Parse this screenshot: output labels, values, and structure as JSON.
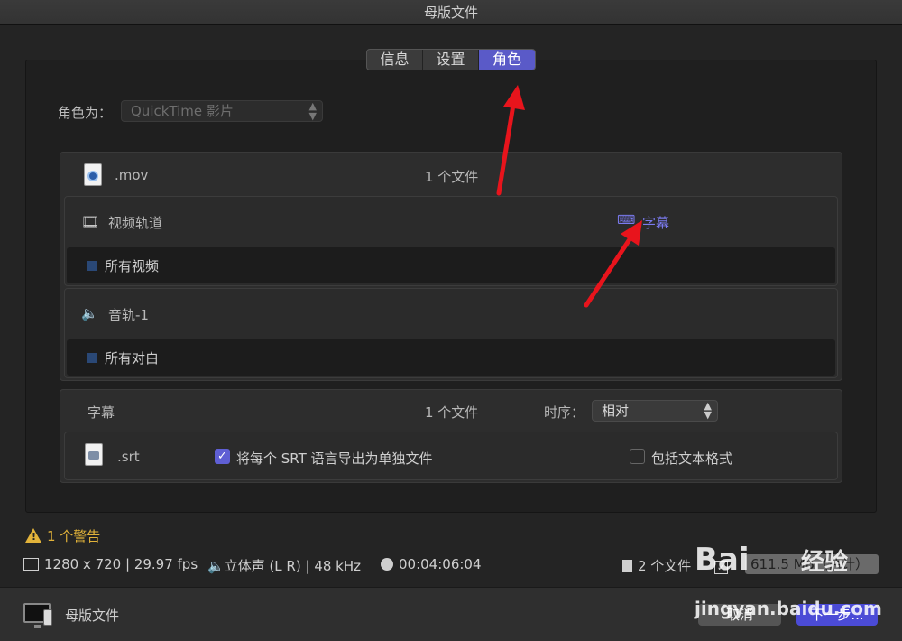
{
  "window": {
    "title": "母版文件"
  },
  "tabs": [
    {
      "label": "信息",
      "active": false
    },
    {
      "label": "设置",
      "active": false
    },
    {
      "label": "角色",
      "active": true
    }
  ],
  "role": {
    "label": "角色为：",
    "value": "QuickTime 影片"
  },
  "mov_group": {
    "ext": ".mov",
    "count": "1 个文件",
    "video_track": {
      "label": "视频轨道",
      "role_tag": "字幕",
      "sub_label": "所有视频"
    },
    "audio_track": {
      "label": "音轨-1",
      "sub_label": "所有对白"
    }
  },
  "subtitle_group": {
    "label": "字幕",
    "count": "1 个文件",
    "order_label": "时序：",
    "order_value": "相对",
    "file_ext": ".srt",
    "split_option": "将每个 SRT 语言导出为单独文件",
    "split_checked": true,
    "format_option": "包括文本格式",
    "format_checked": false
  },
  "warning": {
    "text": "1 个警告"
  },
  "status": {
    "resolution": "1280 x 720",
    "fps": "29.97 fps",
    "audio": "立体声 (L R)",
    "rate": "48 kHz",
    "duration": "00:04:06:04",
    "files": "2 个文件",
    "size": "611.5 MB（估计）"
  },
  "footer": {
    "label": "母版文件",
    "cancel": "取消",
    "next": "下一步..."
  },
  "watermark": {
    "brand": "Bai",
    "brand_cn": "经验",
    "url": "jingyan.baidu.com"
  },
  "colors": {
    "accent": "#5a5ac8",
    "warning": "#e2b33a",
    "annotation_arrow": "#e8141c"
  },
  "icons": [
    "quicktime-file-icon",
    "film-strip-icon",
    "speaker-icon",
    "subtitle-icon",
    "warning-icon",
    "clock-icon",
    "monitor-icon"
  ]
}
